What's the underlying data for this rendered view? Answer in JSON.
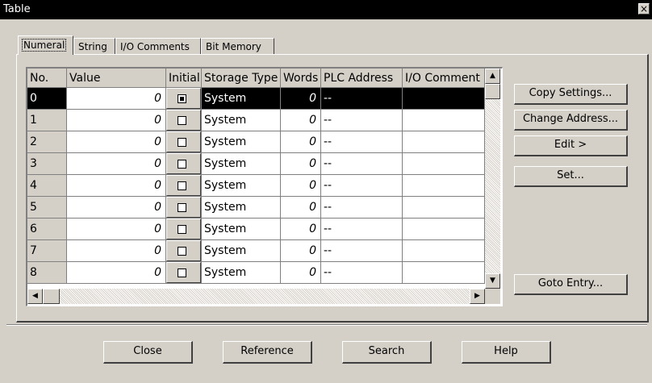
{
  "window": {
    "title": "Table",
    "close_glyph": "×"
  },
  "tabs": [
    {
      "label": "Numeral",
      "active": true
    },
    {
      "label": "String",
      "active": false
    },
    {
      "label": "I/O Comments",
      "active": false
    },
    {
      "label": "Bit Memory",
      "active": false
    }
  ],
  "table": {
    "columns": [
      "No.",
      "Value",
      "Initial",
      "Storage Type",
      "Words",
      "PLC Address",
      "I/O Comment"
    ],
    "rows": [
      {
        "no": "0",
        "value": "0",
        "storage_type": "System",
        "words": "0",
        "plc_address": "--",
        "io_comment": "",
        "selected": true
      },
      {
        "no": "1",
        "value": "0",
        "storage_type": "System",
        "words": "0",
        "plc_address": "--",
        "io_comment": ""
      },
      {
        "no": "2",
        "value": "0",
        "storage_type": "System",
        "words": "0",
        "plc_address": "--",
        "io_comment": ""
      },
      {
        "no": "3",
        "value": "0",
        "storage_type": "System",
        "words": "0",
        "plc_address": "--",
        "io_comment": ""
      },
      {
        "no": "4",
        "value": "0",
        "storage_type": "System",
        "words": "0",
        "plc_address": "--",
        "io_comment": ""
      },
      {
        "no": "5",
        "value": "0",
        "storage_type": "System",
        "words": "0",
        "plc_address": "--",
        "io_comment": ""
      },
      {
        "no": "6",
        "value": "0",
        "storage_type": "System",
        "words": "0",
        "plc_address": "--",
        "io_comment": ""
      },
      {
        "no": "7",
        "value": "0",
        "storage_type": "System",
        "words": "0",
        "plc_address": "--",
        "io_comment": ""
      },
      {
        "no": "8",
        "value": "0",
        "storage_type": "System",
        "words": "0",
        "plc_address": "--",
        "io_comment": ""
      }
    ]
  },
  "side_buttons": {
    "copy_settings": "Copy Settings...",
    "change_address": "Change Address...",
    "edit": "Edit >",
    "set": "Set...",
    "goto_entry": "Goto Entry..."
  },
  "bottom_buttons": {
    "close": "Close",
    "reference": "Reference",
    "search": "Search",
    "help": "Help"
  },
  "scroll_glyphs": {
    "up": "▲",
    "down": "▼",
    "left": "◀",
    "right": "▶"
  }
}
